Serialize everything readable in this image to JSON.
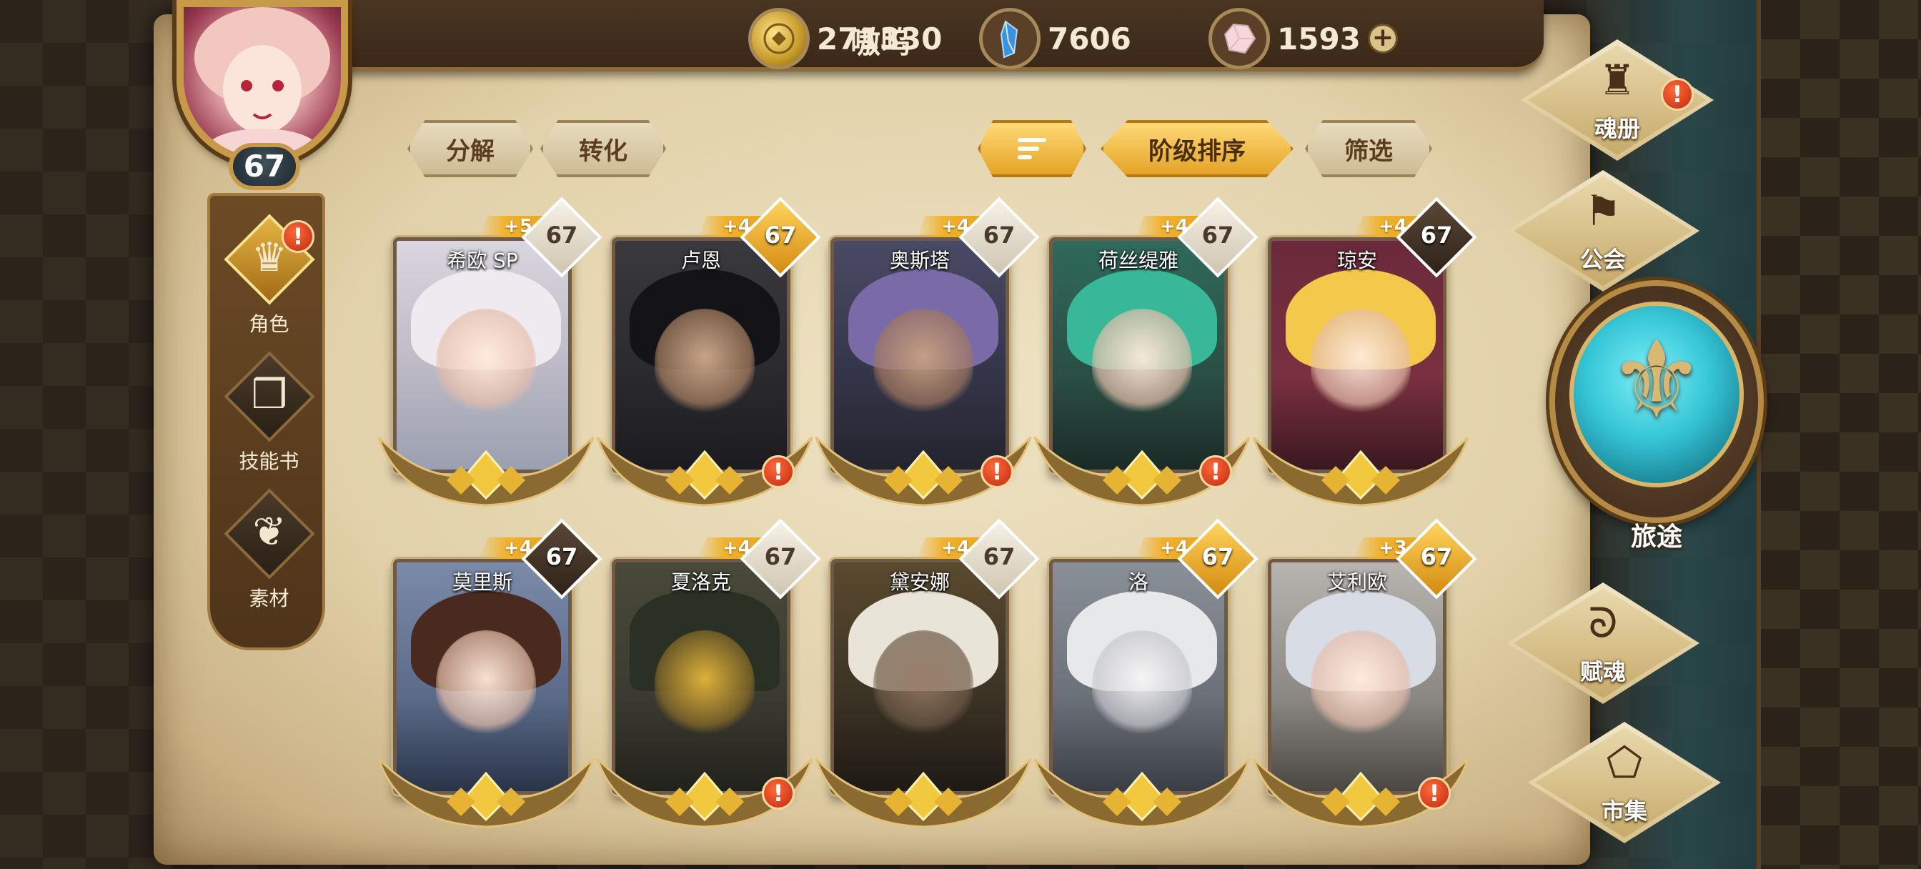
{
  "player": {
    "name": "嗷呜",
    "level": "67"
  },
  "currencies": [
    {
      "icon": "gold-coin-icon",
      "value": "271330"
    },
    {
      "icon": "blue-crystal-icon",
      "value": "7606"
    },
    {
      "icon": "pink-gem-icon",
      "value": "1593",
      "plus": "+"
    }
  ],
  "side_menu": [
    {
      "label": "角色",
      "icon": "character-icon",
      "active": true,
      "alert": "!"
    },
    {
      "label": "技能书",
      "icon": "skill-book-icon"
    },
    {
      "label": "素材",
      "icon": "materials-icon"
    }
  ],
  "actions": {
    "decompose": "分解",
    "convert": "转化",
    "sort_order": "阶级排序",
    "filter": "筛选"
  },
  "heroes": [
    {
      "name": "希欧 SP",
      "plus": "+5",
      "level": "67",
      "badge": "white",
      "alert": false
    },
    {
      "name": "卢恩",
      "plus": "+4",
      "level": "67",
      "badge": "gold",
      "alert": true
    },
    {
      "name": "奥斯塔",
      "plus": "+4",
      "level": "67",
      "badge": "white",
      "alert": true
    },
    {
      "name": "荷丝缇雅",
      "plus": "+4",
      "level": "67",
      "badge": "white",
      "alert": true
    },
    {
      "name": "琼安",
      "plus": "+4",
      "level": "67",
      "badge": "dark",
      "alert": false
    },
    {
      "name": "莫里斯",
      "plus": "+4",
      "level": "67",
      "badge": "dark",
      "alert": false
    },
    {
      "name": "夏洛克",
      "plus": "+4",
      "level": "67",
      "badge": "white",
      "alert": true
    },
    {
      "name": "黛安娜",
      "plus": "+4",
      "level": "67",
      "badge": "white",
      "alert": false
    },
    {
      "name": "洛",
      "plus": "+4",
      "level": "67",
      "badge": "gold",
      "alert": false
    },
    {
      "name": "艾利欧",
      "plus": "+3",
      "level": "67",
      "badge": "gold",
      "alert": true
    }
  ],
  "right_nav": [
    {
      "label": "魂册",
      "icon": "soul-book-icon",
      "alert": "!"
    },
    {
      "label": "公会",
      "icon": "guild-icon"
    },
    {
      "label": "赋魂",
      "icon": "ensoul-icon"
    },
    {
      "label": "市集",
      "icon": "market-icon"
    }
  ],
  "journey": {
    "label": "旅途",
    "icon": "journey-emblem-icon"
  },
  "colors": {
    "parchment": "#e2d1a9",
    "accent_gold": "#e4a426",
    "alert_red": "#c0290f",
    "journey_teal": "#35c5d6"
  }
}
